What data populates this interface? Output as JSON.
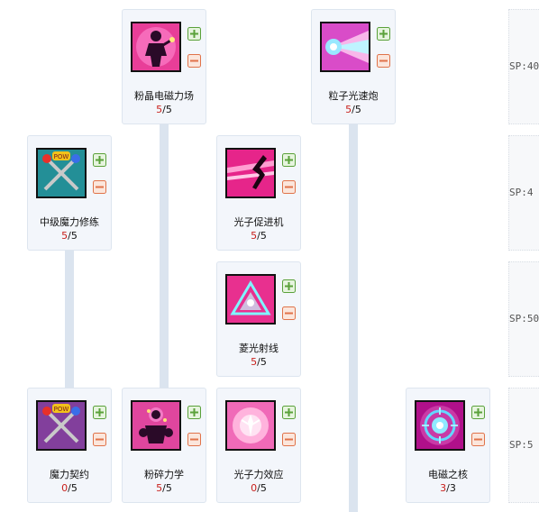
{
  "sp_labels": [
    "SP:40",
    "SP:4",
    "SP:50",
    "SP:5"
  ],
  "skills": [
    {
      "name": "粉晶电磁力场",
      "current": "5",
      "max": "5",
      "icon": "pink-figure-icon"
    },
    {
      "name": "粒子光速炮",
      "current": "5",
      "max": "5",
      "icon": "particle-beam-icon"
    },
    {
      "name": "中级魔力修练",
      "current": "5",
      "max": "5",
      "icon": "pow-wands-icon"
    },
    {
      "name": "光子促进机",
      "current": "5",
      "max": "5",
      "icon": "photon-kick-icon"
    },
    {
      "name": "菱光射线",
      "current": "5",
      "max": "5",
      "icon": "prism-ray-icon"
    },
    {
      "name": "魔力契约",
      "current": "0",
      "max": "5",
      "icon": "pow-wands-purple-icon"
    },
    {
      "name": "粉碎力学",
      "current": "5",
      "max": "5",
      "icon": "crush-mechanics-icon"
    },
    {
      "name": "光子力效应",
      "current": "0",
      "max": "5",
      "icon": "photon-force-icon"
    },
    {
      "name": "电磁之核",
      "current": "3",
      "max": "3",
      "icon": "em-core-icon"
    }
  ],
  "colors": {
    "card_bg": "#f3f6fb",
    "card_border": "#dde5ef",
    "connector": "#dbe4ef",
    "current_level": "#c8201c",
    "plus_button": "#5aa13a",
    "minus_button": "#e0734a"
  }
}
